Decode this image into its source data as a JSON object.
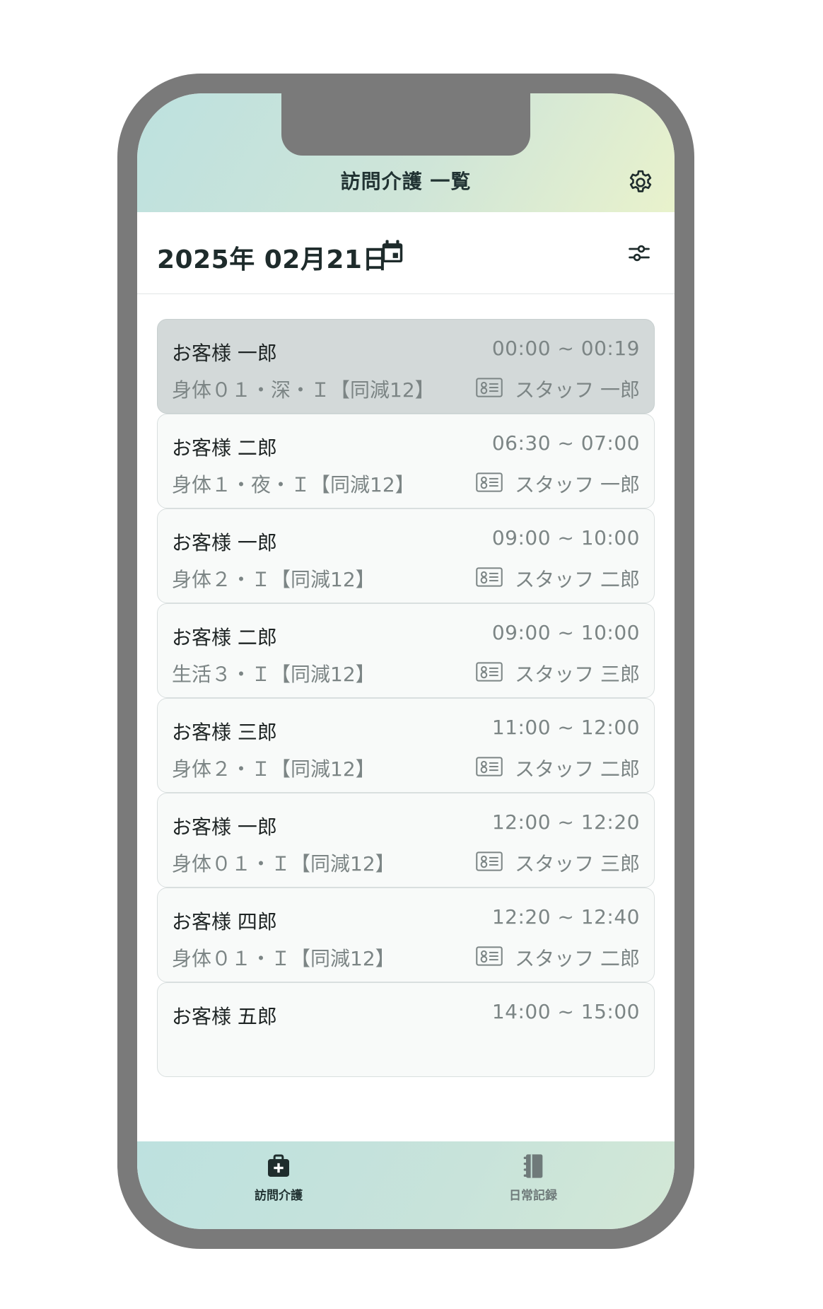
{
  "header": {
    "title": "訪問介護 一覧"
  },
  "date_bar": {
    "date": "2025年 02月21日"
  },
  "visits": [
    {
      "customer": "お客様 一郎",
      "time": "00:00 ~ 00:19",
      "service": "身体０１・深・Ｉ【同減12】",
      "staff": "スタッフ 一郎",
      "selected": true
    },
    {
      "customer": "お客様 二郎",
      "time": "06:30 ~ 07:00",
      "service": "身体１・夜・Ｉ【同減12】",
      "staff": "スタッフ 一郎"
    },
    {
      "customer": "お客様 一郎",
      "time": "09:00 ~ 10:00",
      "service": "身体２・Ｉ【同減12】",
      "staff": "スタッフ 二郎"
    },
    {
      "customer": "お客様 二郎",
      "time": "09:00 ~ 10:00",
      "service": "生活３・Ｉ【同減12】",
      "staff": "スタッフ 三郎"
    },
    {
      "customer": "お客様 三郎",
      "time": "11:00 ~ 12:00",
      "service": "身体２・Ｉ【同減12】",
      "staff": "スタッフ 二郎"
    },
    {
      "customer": "お客様 一郎",
      "time": "12:00 ~ 12:20",
      "service": "身体０１・Ｉ【同減12】",
      "staff": "スタッフ 三郎"
    },
    {
      "customer": "お客様 四郎",
      "time": "12:20 ~ 12:40",
      "service": "身体０１・Ｉ【同減12】",
      "staff": "スタッフ 二郎"
    },
    {
      "customer": "お客様 五郎",
      "time": "14:00 ~ 15:00",
      "service": "",
      "staff": ""
    }
  ],
  "tabs": [
    {
      "label": "訪問介護",
      "icon": "medical-bag-icon",
      "active": true
    },
    {
      "label": "日常記録",
      "icon": "notebook-icon",
      "active": false
    }
  ],
  "icons": {
    "settings": "gear-icon",
    "calendar": "calendar-icon",
    "filter": "filter-sliders-icon",
    "staff": "staff-id-card-icon"
  },
  "colors": {
    "header_gradient_start": "#bde1df",
    "header_gradient_end": "#e9f2cc",
    "selected_card": "#d3d9d9",
    "phone_frame": "#7a7a7a"
  }
}
